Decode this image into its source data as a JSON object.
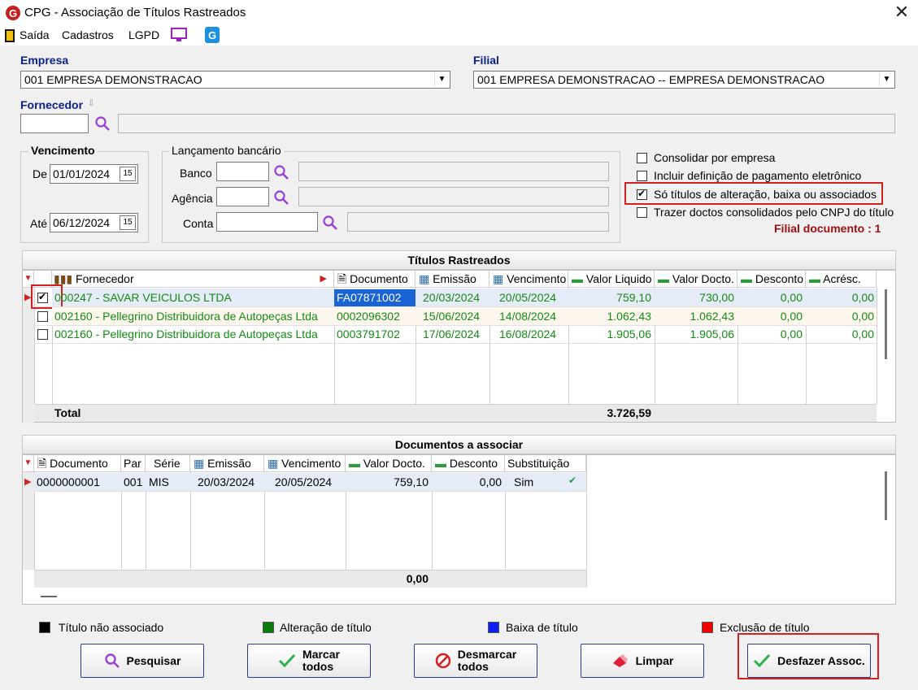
{
  "window": {
    "title": "CPG - Associação de Títulos Rastreados",
    "close": "✕"
  },
  "menu": {
    "exit": "Saída",
    "registers": "Cadastros",
    "lgpd": "LGPD"
  },
  "empresa": {
    "label": "Empresa",
    "value": "001 EMPRESA DEMONSTRACAO"
  },
  "filial": {
    "label": "Filial",
    "value": "001 EMPRESA DEMONSTRACAO -- EMPRESA DEMONSTRACAO"
  },
  "fornecedor": {
    "label": "Fornecedor",
    "value": "",
    "name": ""
  },
  "vencimento": {
    "title": "Vencimento",
    "from_label": "De",
    "from": "01/01/2024",
    "to_label": "Até",
    "to": "06/12/2024",
    "cal": "15"
  },
  "lancamento": {
    "title": "Lançamento bancário",
    "bank_label": "Banco",
    "agency_label": "Agência",
    "account_label": "Conta"
  },
  "options": [
    {
      "label": "Consolidar por empresa",
      "checked": false
    },
    {
      "label": "Incluir definição de pagamento eletrônico",
      "checked": false
    },
    {
      "label": "Só títulos de alteração, baixa ou associados",
      "checked": true
    },
    {
      "label": "Trazer doctos consolidados pelo CNPJ do título",
      "checked": false
    }
  ],
  "filial_documento": "Filial documento : 1",
  "titulos": {
    "title": "Títulos Rastreados",
    "headers": [
      "Fornecedor",
      "Documento",
      "Emissão",
      "Vencimento",
      "Valor Liquido",
      "Valor Docto.",
      "Desconto",
      "Acrésc."
    ],
    "rows": [
      {
        "checked": true,
        "fornecedor": "000247 - SAVAR VEICULOS LTDA",
        "documento": "FA07871002",
        "emissao": "20/03/2024",
        "vencimento": "20/05/2024",
        "liquido": "759,10",
        "docto": "730,00",
        "desconto": "0,00",
        "acresc": "0,00"
      },
      {
        "checked": false,
        "fornecedor": "002160 - Pellegrino Distribuidora de Autopeças Ltda",
        "documento": "0002096302",
        "emissao": "15/06/2024",
        "vencimento": "14/08/2024",
        "liquido": "1.062,43",
        "docto": "1.062,43",
        "desconto": "0,00",
        "acresc": "0,00"
      },
      {
        "checked": false,
        "fornecedor": "002160 - Pellegrino Distribuidora de Autopeças Ltda",
        "documento": "0003791702",
        "emissao": "17/06/2024",
        "vencimento": "16/08/2024",
        "liquido": "1.905,06",
        "docto": "1.905,06",
        "desconto": "0,00",
        "acresc": "0,00"
      }
    ],
    "total_label": "Total",
    "total_value": "3.726,59"
  },
  "documentos": {
    "title": "Documentos a associar",
    "headers": [
      "Documento",
      "Par",
      "Série",
      "Emissão",
      "Vencimento",
      "Valor Docto.",
      "Desconto",
      "Substituição"
    ],
    "rows": [
      {
        "documento": "0000000001",
        "par": "001",
        "serie": "MIS",
        "emissao": "20/03/2024",
        "vencimento": "20/05/2024",
        "valor": "759,10",
        "desconto": "0,00",
        "subst": "Sim"
      }
    ],
    "total_value": "0,00"
  },
  "legend": [
    {
      "label": "Título não associado",
      "color": "#000000"
    },
    {
      "label": "Alteração de título",
      "color": "#0a7a0a"
    },
    {
      "label": "Baixa de título",
      "color": "#0a1ef0"
    },
    {
      "label": "Exclusão de título",
      "color": "#f00000"
    }
  ],
  "buttons": {
    "pesquisar": "Pesquisar",
    "marcar_1": "Marcar",
    "marcar_2": "todos",
    "desmarcar_1": "Desmarcar",
    "desmarcar_2": "todos",
    "limpar": "Limpar",
    "desfazer": "Desfazer Assoc."
  }
}
